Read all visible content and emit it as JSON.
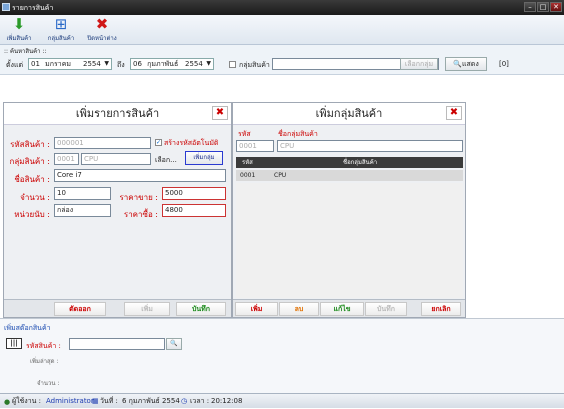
{
  "window": {
    "title": "รายการสินค้า",
    "min": "–",
    "max": "□",
    "close": "✕"
  },
  "toolbar": {
    "add_product": "เพิ่มสินค้า",
    "product_group": "กลุ่มสินค้า",
    "close_window": "ปิดหน้าต่าง"
  },
  "search": {
    "section_title": ":: ค้นหาสินค้า ::",
    "from_label": "ตั้งแต่",
    "from_day": "01",
    "from_month": "มกราคม",
    "from_year": "2554",
    "to_label": "ถึง",
    "to_day": "06",
    "to_month": "กุมภาพันธ์",
    "to_year": "2554",
    "group_checkbox_label": "กลุ่มสินค้า",
    "group_value": "",
    "select_button": "เลือกกลุ่ม",
    "show_button": "แสดง",
    "result_count": "[0]"
  },
  "add_product": {
    "title": "เพิ่มรายการสินค้า",
    "code_label": "รหัสสินค้า :",
    "code_value": "000001",
    "auto_code_label": "สร้างรหัสอัตโนมัติ",
    "group_label": "กลุ่มสินค้า :",
    "group_code": "0001",
    "group_name": "CPU",
    "choose_button": "เลือก...",
    "add_group_button": "เพิ่มกลุ่ม",
    "name_label": "ชื่อสินค้า :",
    "name_value": "Core i7",
    "qty_label": "จำนวน :",
    "qty_value": "10",
    "sell_price_label": "ราคาขาย :",
    "sell_price_value": "5000",
    "unit_label": "หน่วยนับ :",
    "unit_value": "กล่อง",
    "cost_price_label": "ราคาซื้อ :",
    "cost_price_value": "4800",
    "cut_button": "ตัดออก",
    "add_button": "เพิ่ม",
    "save_button": "บันทึก"
  },
  "add_group": {
    "title": "เพิ่มกลุ่มสินค้า",
    "code_label": "รหัส",
    "name_label": "ชื่อกลุ่มสินค้า",
    "code_value": "0001",
    "name_value": "CPU",
    "columns": [
      "รหัส",
      "ชื่อกลุ่มสินค้า"
    ],
    "rows": [
      [
        "0001",
        "CPU"
      ]
    ],
    "add_button": "เพิ่ม",
    "delete_button": "ลบ",
    "edit_button": "แก้ไข",
    "save_button": "บันทึก",
    "cancel_button": "ยกเลิก"
  },
  "stock": {
    "section_title": "เพิ่มสต๊อกสินค้า",
    "code_label": "รหัสสินค้า :",
    "code_value": "",
    "latest_label": "เพิ่มล่าสุด :",
    "qty_label": "จำนวน :"
  },
  "status": {
    "user_label": "ผู้ใช้งาน :",
    "user_value": "Administrator",
    "date_label": "วันที่ :",
    "date_value": "6 กุมภาพันธ์ 2554",
    "time_label": "เวลา :",
    "time_value": "20:12:08"
  }
}
